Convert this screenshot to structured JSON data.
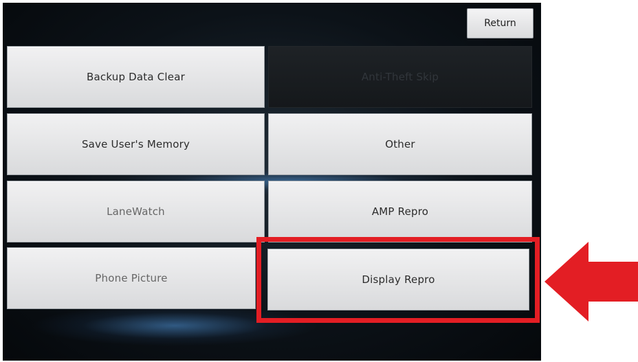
{
  "header": {
    "return_label": "Return"
  },
  "menu": {
    "backup_data_clear": "Backup Data Clear",
    "anti_theft_skip": "Anti-Theft Skip",
    "save_users_memory": "Save User's Memory",
    "other": "Other",
    "lanewatch": "LaneWatch",
    "amp_repro": "AMP Repro",
    "phone_picture": "Phone Picture",
    "display_repro": "Display Repro"
  },
  "annotation": {
    "highlight_color": "#e31e24",
    "arrow_color": "#e31e24"
  }
}
